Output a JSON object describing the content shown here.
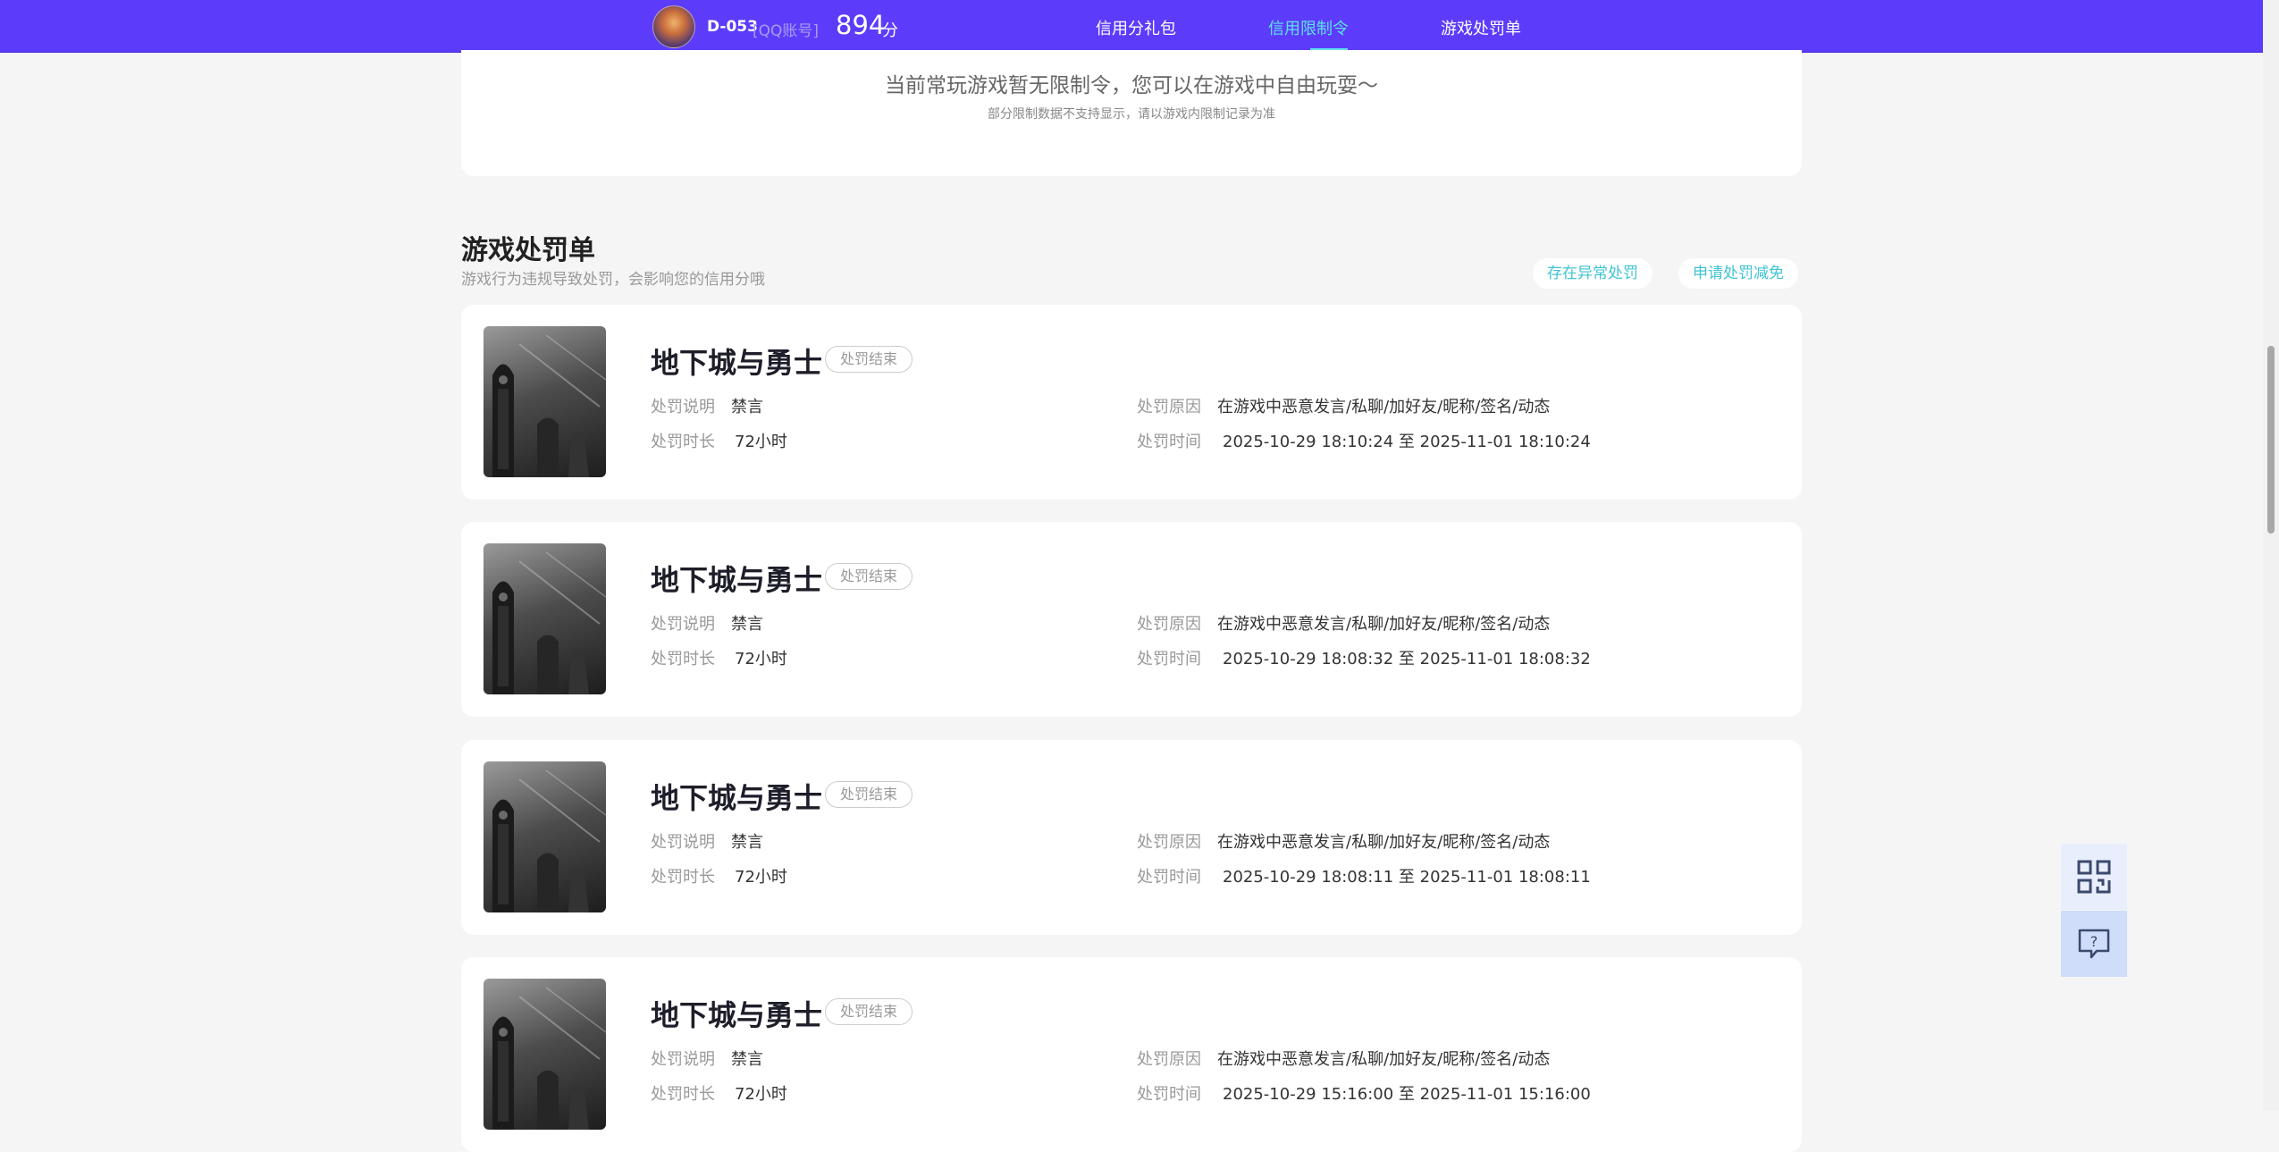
{
  "header": {
    "user_name": "D-053",
    "account_type": "[QQ账号]",
    "score": "894",
    "score_unit": "分",
    "nav": [
      {
        "label": "信用分礼包",
        "active": false
      },
      {
        "label": "信用限制令",
        "active": true
      },
      {
        "label": "游戏处罚单",
        "active": false
      }
    ],
    "bar_color": "#5c3cfa",
    "active_color": "#5ee0ee"
  },
  "notice": {
    "main_text": "当前常玩游戏暂无限制令，您可以在游戏中自由玩耍～",
    "sub_text": "部分限制数据不支持显示，请以游戏内限制记录为准"
  },
  "section": {
    "title": "游戏处罚单",
    "subtitle": "游戏行为违规导致处罚，会影响您的信用分哦",
    "buttons": [
      "存在异常处罚",
      "申请处罚减免"
    ]
  },
  "labels": {
    "desc": "处罚说明",
    "duration": "处罚时长",
    "reason": "处罚原因",
    "time": "处罚时间"
  },
  "penalties": [
    {
      "game": "地下城与勇士",
      "status": "处罚结束",
      "desc": "禁言",
      "duration": "72小时",
      "reason": "在游戏中恶意发言/私聊/加好友/昵称/签名/动态",
      "time": "2025-10-29 18:10:24 至 2025-11-01 18:10:24"
    },
    {
      "game": "地下城与勇士",
      "status": "处罚结束",
      "desc": "禁言",
      "duration": "72小时",
      "reason": "在游戏中恶意发言/私聊/加好友/昵称/签名/动态",
      "time": "2025-10-29 18:08:32 至 2025-11-01 18:08:32"
    },
    {
      "game": "地下城与勇士",
      "status": "处罚结束",
      "desc": "禁言",
      "duration": "72小时",
      "reason": "在游戏中恶意发言/私聊/加好友/昵称/签名/动态",
      "time": "2025-10-29 18:08:11 至 2025-11-01 18:08:11"
    },
    {
      "game": "地下城与勇士",
      "status": "处罚结束",
      "desc": "禁言",
      "duration": "72小时",
      "reason": "在游戏中恶意发言/私聊/加好友/昵称/签名/动态",
      "time": "2025-10-29 15:16:00 至 2025-11-01 15:16:00"
    }
  ],
  "floating_tools": [
    {
      "icon": "qr-code-icon"
    },
    {
      "icon": "help-chat-icon"
    }
  ]
}
